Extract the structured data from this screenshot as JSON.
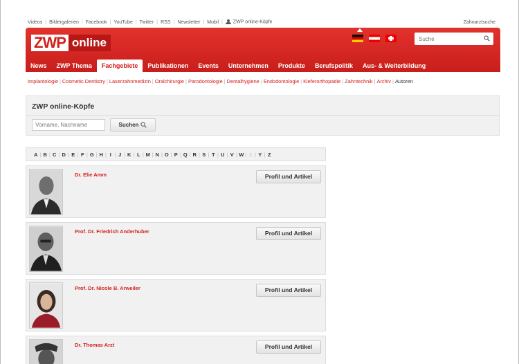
{
  "topbar": {
    "links": [
      "Videos",
      "Bildergalerien",
      "Facebook",
      "YouTube",
      "Twitter",
      "RSS",
      "Newsletter",
      "Mobil"
    ],
    "user_link": "ZWP online-Köpfe",
    "right_link": "Zahnarztsuche"
  },
  "header": {
    "logo_zwp": "ZWP",
    "logo_online": "online",
    "search_placeholder": "Suche",
    "nav": [
      "News",
      "ZWP Thema",
      "Fachgebiete",
      "Publikationen",
      "Events",
      "Unternehmen",
      "Produkte",
      "Berufspolitik",
      "Aus- & Weiterbildung"
    ],
    "active_nav": "Fachgebiete"
  },
  "subnav": [
    "Implantologie",
    "Cosmetic Dentistry",
    "Laserzahnmedizin",
    "Oralchirurgie",
    "Parodontologie",
    "Dentalhygiene",
    "Endodontologie",
    "Kieferorthopädie",
    "Zahntechnik",
    "Archiv"
  ],
  "subnav_current": "Autoren",
  "page": {
    "title": "ZWP online-Köpfe",
    "name_placeholder": "Vorname, Nachname",
    "search_button": "Suchen"
  },
  "alphabet": [
    "A",
    "B",
    "C",
    "D",
    "E",
    "F",
    "G",
    "H",
    "I",
    "J",
    "K",
    "L",
    "M",
    "N",
    "O",
    "P",
    "Q",
    "R",
    "S",
    "T",
    "U",
    "V",
    "W",
    "X",
    "Y",
    "Z"
  ],
  "alphabet_disabled": [
    "X"
  ],
  "entries": [
    {
      "name": "Dr. Elie Amm",
      "button": "Profil und Artikel"
    },
    {
      "name": "Prof. Dr. Friedrich Anderhuber",
      "button": "Profil und Artikel"
    },
    {
      "name": "Prof. Dr. Nicole B. Arweiler",
      "button": "Profil und Artikel"
    },
    {
      "name": "Dr. Thomas Arzt",
      "button": "Profil und Artikel"
    }
  ],
  "colors": {
    "brand_red": "#d2211d",
    "panel_gray": "#f1f1f1"
  }
}
